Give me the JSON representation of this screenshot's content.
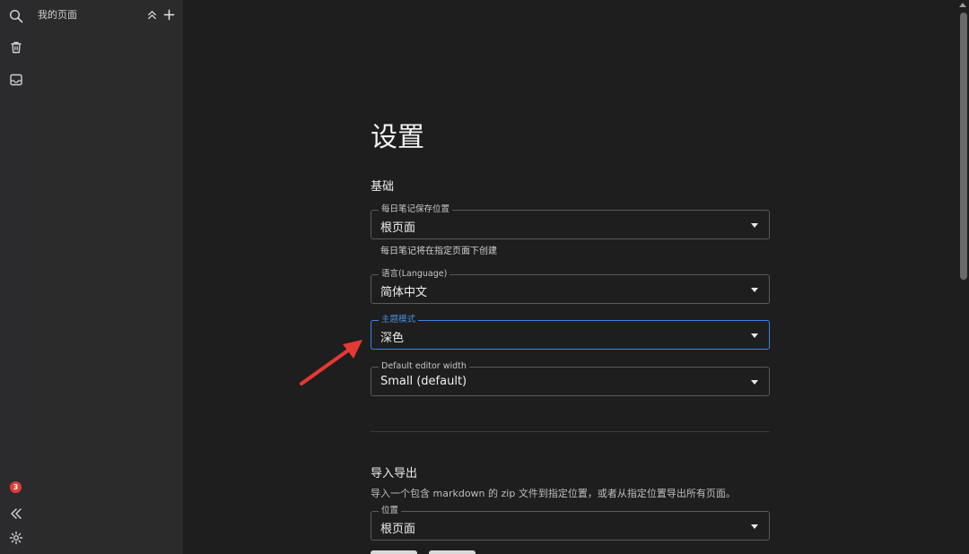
{
  "rail": {
    "icons": [
      "search-icon",
      "trash-icon",
      "inbox-icon",
      "collapse-double-left-icon",
      "gear-icon"
    ],
    "notification_count": "3"
  },
  "sidebar": {
    "title": "我的页面",
    "buttons": [
      "collapse-all-icon",
      "plus-icon"
    ]
  },
  "settings": {
    "title": "设置",
    "basic": {
      "heading": "基础",
      "daily_note_location": {
        "label": "每日笔记保存位置",
        "value": "根页面",
        "helper": "每日笔记将在指定页面下创建"
      },
      "language": {
        "label": "语言(Language)",
        "value": "简体中文"
      },
      "theme": {
        "label": "主题模式",
        "value": "深色"
      },
      "editor_width": {
        "label": "Default editor width",
        "value": "Small (default)"
      }
    },
    "import_export": {
      "heading": "导入导出",
      "description": "导入一个包含 markdown 的 zip 文件到指定位置，或者从指定位置导出所有页面。",
      "location": {
        "label": "位置",
        "value": "根页面"
      }
    }
  },
  "colors": {
    "focus_accent": "#3d84e6",
    "annotation_arrow": "#e53935",
    "badge": "#e23b3b"
  }
}
